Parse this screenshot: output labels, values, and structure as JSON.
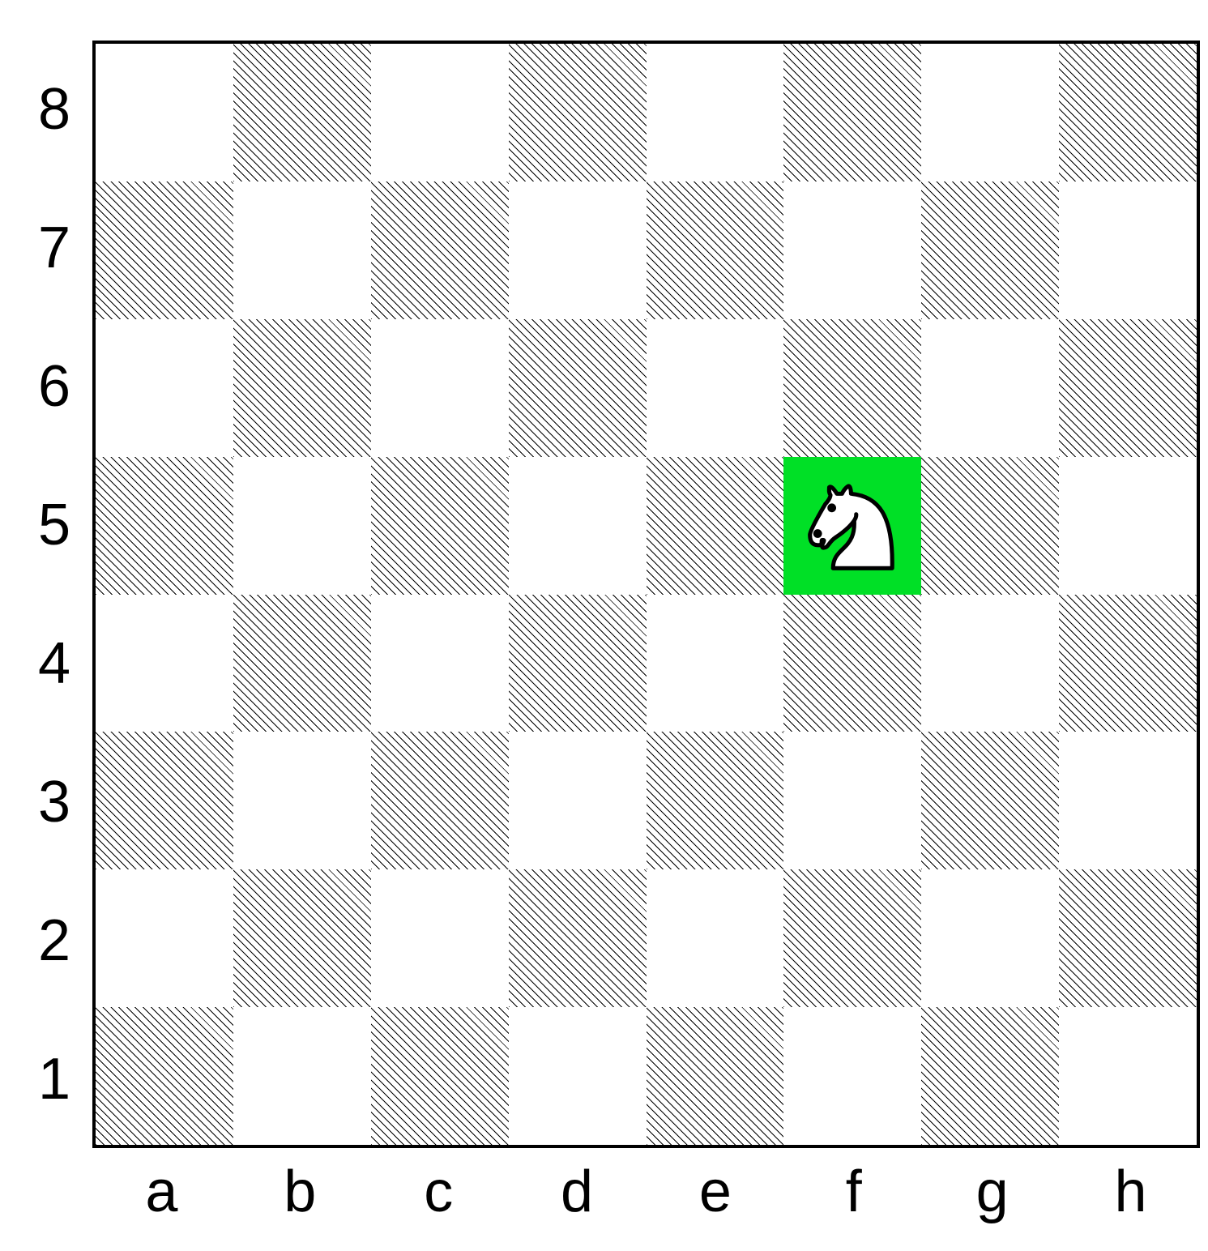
{
  "board": {
    "files": [
      "a",
      "b",
      "c",
      "d",
      "e",
      "f",
      "g",
      "h"
    ],
    "ranks_top_to_bottom": [
      "8",
      "7",
      "6",
      "5",
      "4",
      "3",
      "2",
      "1"
    ],
    "highlighted_squares": [
      "f5"
    ],
    "highlight_color": "#00e026",
    "pieces": [
      {
        "square": "f5",
        "piece": "N",
        "color": "white",
        "name": "white knight"
      }
    ]
  },
  "chart_data": {
    "type": "table",
    "description": "8x8 chessboard with a single white knight on f5, that square highlighted green",
    "files": [
      "a",
      "b",
      "c",
      "d",
      "e",
      "f",
      "g",
      "h"
    ],
    "ranks": [
      "1",
      "2",
      "3",
      "4",
      "5",
      "6",
      "7",
      "8"
    ],
    "placements": [
      {
        "file": "f",
        "rank": "5",
        "piece": "white knight"
      }
    ],
    "highlights": [
      {
        "file": "f",
        "rank": "5",
        "color": "#00e026"
      }
    ]
  }
}
